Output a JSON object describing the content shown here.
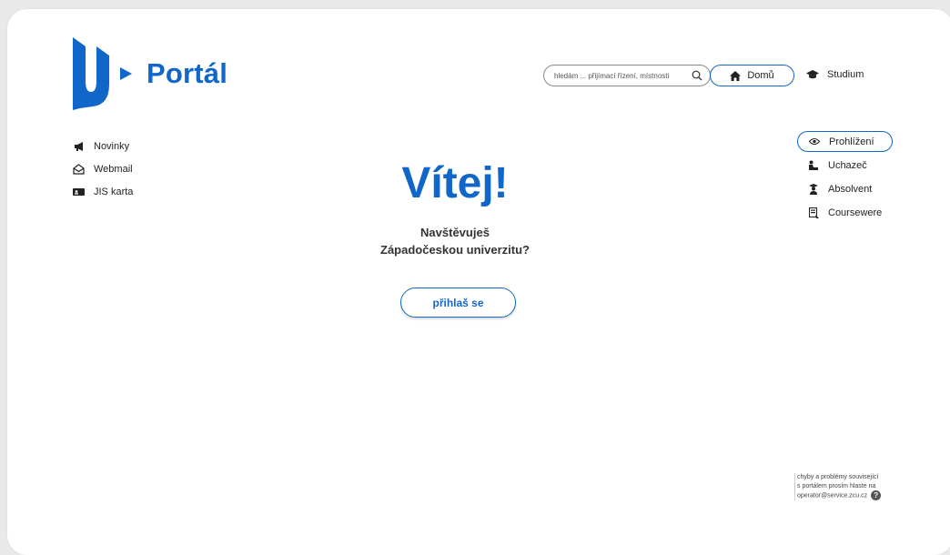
{
  "brand": {
    "name": "Portál",
    "accent": "#1167c9"
  },
  "search": {
    "placeholder": "hledám ... přijímací řízení, místnosti",
    "icon": "search-icon"
  },
  "header": {
    "home_label": "Domů",
    "studium_label": "Studium"
  },
  "left_nav": [
    {
      "label": "Novinky",
      "icon": "megaphone-icon"
    },
    {
      "label": "Webmail",
      "icon": "envelope-icon"
    },
    {
      "label": "JIS karta",
      "icon": "id-card-icon"
    }
  ],
  "right_nav": [
    {
      "label": "Prohlížení",
      "icon": "eye-icon",
      "active": true
    },
    {
      "label": "Uchazeč",
      "icon": "applicant-icon"
    },
    {
      "label": "Absolvent",
      "icon": "graduate-icon"
    },
    {
      "label": "Coursewere",
      "icon": "courseware-icon"
    }
  ],
  "hero": {
    "title": "Vítej!",
    "subtitle_line1": "Navštěvuješ",
    "subtitle_line2": "Západočeskou univerzitu?",
    "login_label": "přihlaš se"
  },
  "support": {
    "line1": "chyby a problémy související",
    "line2": "s portálem prosím hlaste na",
    "line3": "operator@service.zcu.cz",
    "help_glyph": "?"
  }
}
